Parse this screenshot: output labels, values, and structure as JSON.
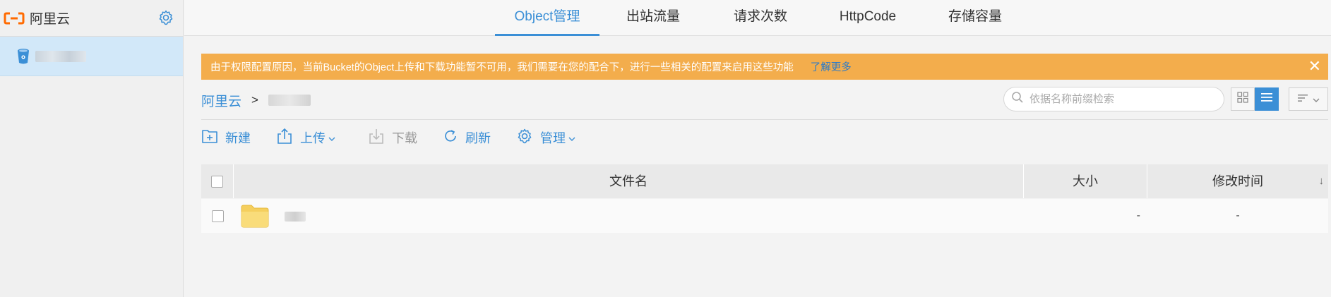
{
  "sidebar": {
    "title": "阿里云",
    "bucket_name": ""
  },
  "tabs": [
    {
      "label": "Object管理",
      "active": true
    },
    {
      "label": "出站流量",
      "active": false
    },
    {
      "label": "请求次数",
      "active": false
    },
    {
      "label": "HttpCode",
      "active": false
    },
    {
      "label": "存储容量",
      "active": false
    }
  ],
  "banner": {
    "message": "由于权限配置原因，当前Bucket的Object上传和下载功能暂不可用，我们需要在您的配合下，进行一些相关的配置来启用这些功能",
    "link": "了解更多",
    "close": "✕"
  },
  "breadcrumb": {
    "root": "阿里云",
    "separator": ">"
  },
  "search": {
    "placeholder": "依据名称前缀检索"
  },
  "toolbar": {
    "new_label": "新建",
    "upload_label": "上传",
    "download_label": "下载",
    "refresh_label": "刷新",
    "manage_label": "管理"
  },
  "table": {
    "columns": [
      "文件名",
      "大小",
      "修改时间"
    ],
    "sort_indicator": "↓",
    "rows": [
      {
        "type": "folder",
        "name": "",
        "size": "-",
        "modified": "-"
      }
    ]
  },
  "colors": {
    "accent": "#3b8fd6",
    "banner": "#f3ad4c",
    "sidebar_selected": "#d2e8f9",
    "folder": "#f7d56b"
  }
}
